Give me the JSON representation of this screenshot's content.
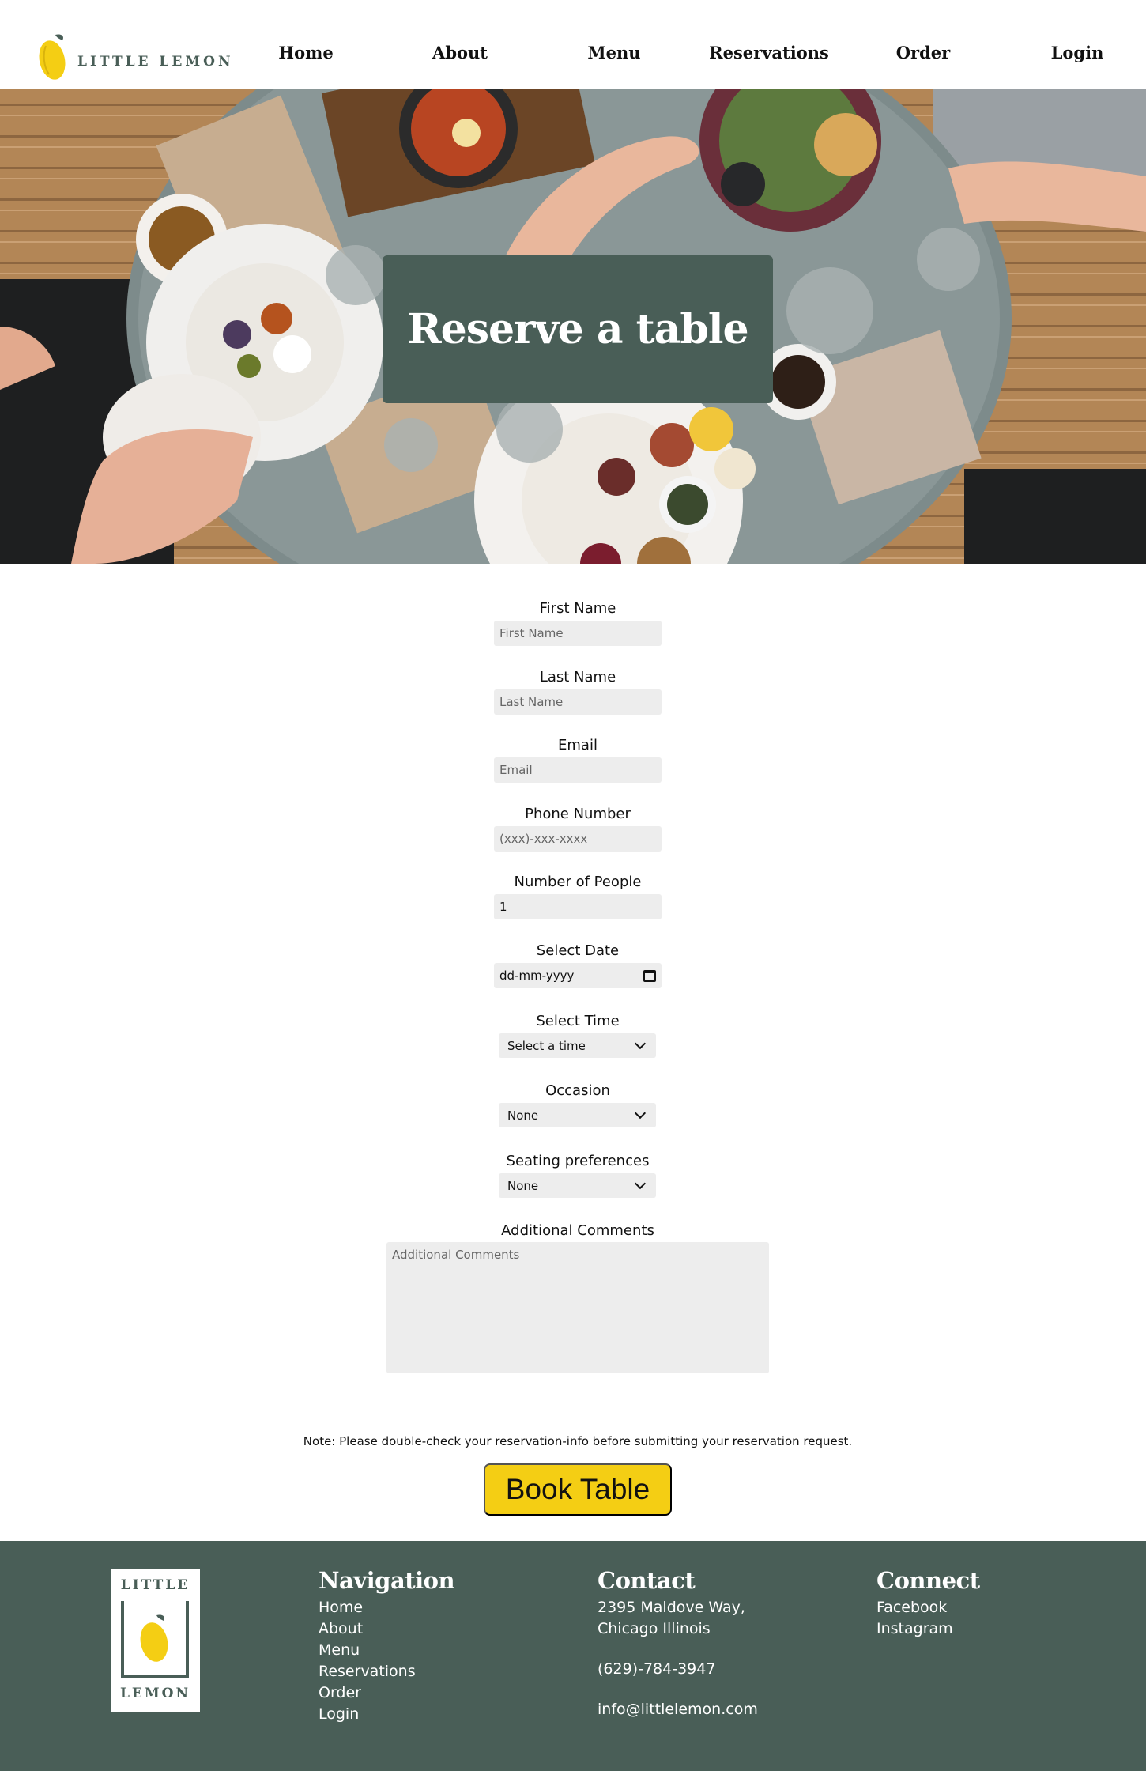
{
  "brand": {
    "name": "LITTLE LEMON",
    "footer_top": "LITTLE",
    "footer_bottom": "LEMON",
    "accent": "#f4ce14",
    "primary": "#495e57"
  },
  "nav": [
    "Home",
    "About",
    "Menu",
    "Reservations",
    "Order",
    "Login"
  ],
  "hero": {
    "title": "Reserve a table"
  },
  "form": {
    "first_name": {
      "label": "First Name",
      "placeholder": "First Name"
    },
    "last_name": {
      "label": "Last Name",
      "placeholder": "Last Name"
    },
    "email": {
      "label": "Email",
      "placeholder": "Email"
    },
    "phone": {
      "label": "Phone Number",
      "placeholder": "(xxx)-xxx-xxxx"
    },
    "people": {
      "label": "Number of People",
      "value": "1"
    },
    "date": {
      "label": "Select Date",
      "value": "dd-mm-yyyy"
    },
    "time": {
      "label": "Select Time",
      "selected": "Select a time"
    },
    "occasion": {
      "label": "Occasion",
      "selected": "None"
    },
    "seating": {
      "label": "Seating preferences",
      "selected": "None"
    },
    "comments": {
      "label": "Additional Comments",
      "placeholder": "Additional Comments"
    },
    "note": "Note: Please double-check your reservation-info before submitting your reservation request.",
    "submit": "Book Table"
  },
  "footer": {
    "navigation": {
      "heading": "Navigation",
      "links": [
        "Home",
        "About",
        "Menu",
        "Reservations",
        "Order",
        "Login"
      ]
    },
    "contact": {
      "heading": "Contact",
      "address_line1": "2395 Maldove Way,",
      "address_line2": "Chicago Illinois",
      "phone": "(629)-784-3947",
      "email": "info@littlelemon.com"
    },
    "connect": {
      "heading": "Connect",
      "links": [
        "Facebook",
        "Instagram"
      ]
    }
  }
}
